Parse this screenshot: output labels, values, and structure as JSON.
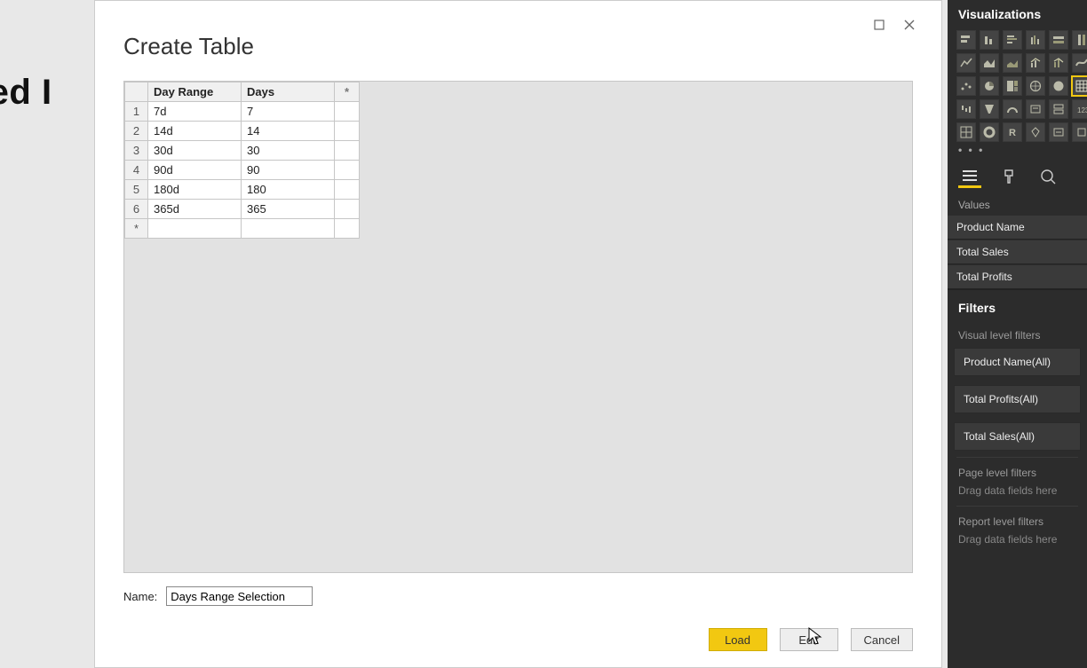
{
  "background": {
    "text": "aded I"
  },
  "modal": {
    "title": "Create Table",
    "table": {
      "columns": [
        "Day Range",
        "Days"
      ],
      "star": "*",
      "rows": [
        {
          "n": "1",
          "range": "7d",
          "days": "7"
        },
        {
          "n": "2",
          "range": "14d",
          "days": "14"
        },
        {
          "n": "3",
          "range": "30d",
          "days": "30"
        },
        {
          "n": "4",
          "range": "90d",
          "days": "90"
        },
        {
          "n": "5",
          "range": "180d",
          "days": "180"
        },
        {
          "n": "6",
          "range": "365d",
          "days": "365"
        }
      ],
      "newrow": "*"
    },
    "name_label": "Name:",
    "name_value": "Days Range Selection",
    "buttons": {
      "load": "Load",
      "edit": "Edit",
      "cancel": "Cancel"
    }
  },
  "vis": {
    "title": "Visualizations",
    "ellipsis": "• • •",
    "values_label": "Values",
    "values": [
      "Product Name",
      "Total Sales",
      "Total Profits"
    ],
    "filters_title": "Filters",
    "visual_filters_label": "Visual level filters",
    "visual_filters": [
      "Product Name(All)",
      "Total Profits(All)",
      "Total Sales(All)"
    ],
    "page_filters_label": "Page level filters",
    "page_filters_drop": "Drag data fields here",
    "report_filters_label": "Report level filters",
    "report_filters_drop": "Drag data fields here"
  }
}
